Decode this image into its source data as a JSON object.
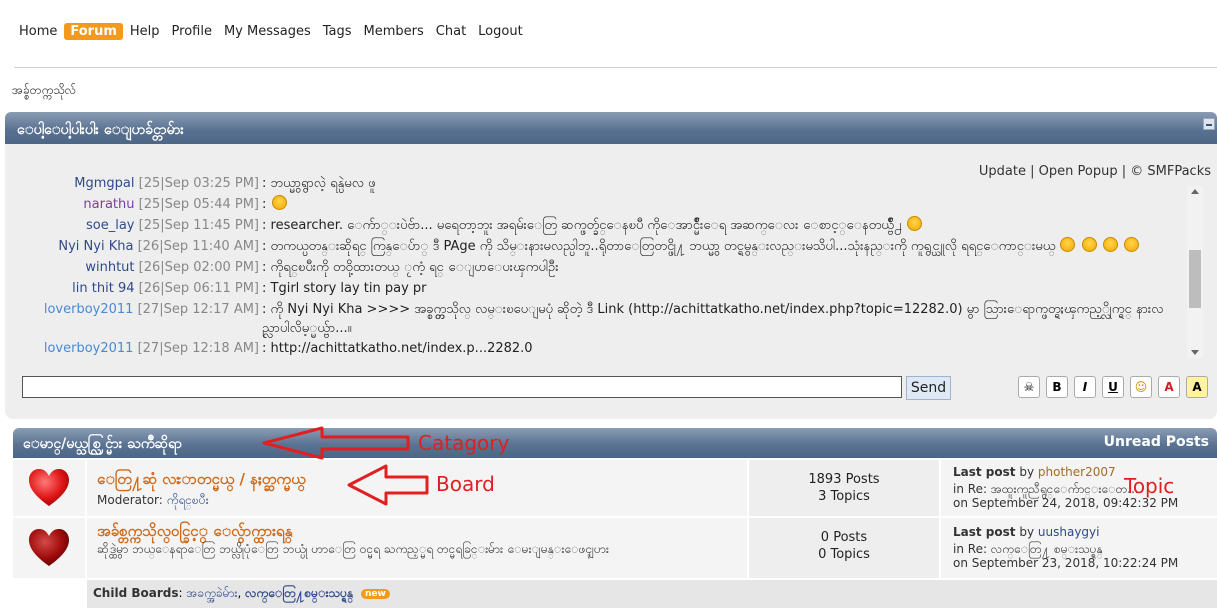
{
  "nav": {
    "items": [
      "Home",
      "Forum",
      "Help",
      "Profile",
      "My Messages",
      "Tags",
      "Members",
      "Chat",
      "Logout"
    ],
    "active": "Forum"
  },
  "breadcrumb": "အခ္စ်တက္ကသိုလ်",
  "shoutbox": {
    "title": "ေပါ့ေပါ့ပါးပါး ေျပာခ်င္တာမ်ား",
    "links": {
      "update": "Update",
      "sep1": "|",
      "popup": "Open Popup",
      "sep2": "|",
      "credit": "© SMFPacks"
    },
    "shouts": [
      {
        "name": "Mgmgpal",
        "color": "#2f4a8a",
        "time": "[25|Sep 03:25 PM]",
        "msg": ": ဘယ္မွာရွာလဲ့ ရန္ပဲမလ ဖူ"
      },
      {
        "name": "narathu",
        "color": "#7a3fa0",
        "time": "[25|Sep 05:44 PM]",
        "msg": ": "
      },
      {
        "name": "soe_lay",
        "color": "#2f4a8a",
        "time": "[25|Sep 11:45 PM]",
        "msg": ": researcher. ေက်ာ္းပဲဗ်ာ... မရေတာ့ဘူး အရမ်းေတြ ဆက္ဖတ္ခ်င္ေနၿပီ ကိုေအာင္မ်ိဳးေရ အဆက္ေလး ေစာင့္ေနတယ္ဗ်ိဳ႕"
      },
      {
        "name": "Nyi Nyi Kha",
        "color": "#2f4a8a",
        "time": "[26|Sep 11:40 AM]",
        "msg": ": တကယ္ပတန္းဆိုရင္ ကြန္ေပ်ာ္ ဒီ PAge ကို သိမ္းနားမလည္ပါဘူ..ရိုတာေတြတင္ဖို႔ ဘယ္မွာ တင္ရမွန္းလည္းမသိပါ...သုံးနည္းကို ကူရွင္ယူလို ရရင္ေကာင္းမယ္"
      },
      {
        "name": "winhtut",
        "color": "#2f4a8a",
        "time": "[26|Sep 02:00 PM]",
        "msg": ": ကိုရင္ၿပီးကို တဝို့ထားတယ္ ႂကံ့ ရင္ ေျပာေပးၾကပါဦး"
      },
      {
        "name": "lin thit 94",
        "color": "#2f4a8a",
        "time": "[26|Sep 06:11 PM]",
        "msg": ": Tgirl story lay tin pay pr"
      },
      {
        "name": "loverboy2011",
        "color": "#4a8ad0",
        "time": "[27|Sep 12:17 AM]",
        "msg": ": ကို Nyi Nyi Kha >>>> အခ္စ္တက္ကသိုလ္ လမ္းၿပေျမပုံ ဆိုတဲ့ ဒီ Link (http://achittatkatho.net/index.php?topic=12282.0) မွာ သြားေရာက္ဖတ္ရႈၾကည့္လိုက္ရင္ နားလည္လာပါလိမ့္မယ္ဗ်ာ...။"
      },
      {
        "name": "loverboy2011",
        "color": "#4a8ad0",
        "time": "[27|Sep 12:18 AM]",
        "msg": ": http://achittatkatho.net/index.p...2282.0"
      }
    ],
    "send_label": "Send",
    "tools": [
      "☠",
      "B",
      "I",
      "U",
      "☺",
      "A",
      "A"
    ]
  },
  "category": {
    "title": "ေမာင္/မယ္သစ္လြင္မ်ား ႀကိဳဆိုရာ",
    "unread": "Unread Posts"
  },
  "boards": [
    {
      "name": "ေတြ႔ဆုံ လႊာတင္မယ္ / နႈတ္ဆက္မယ္",
      "moderator_label": "Moderator:",
      "moderator": "ကိုရင္ၿပီး",
      "posts": "1893 Posts",
      "topics": "3 Topics",
      "last_label": "Last post",
      "by": "by",
      "poster": "phother2007",
      "in": "in",
      "topic": "Re: အထူးကူညီရွင္ေက်ာင္းေတ...",
      "on": "on September 24, 2018, 09:42:32 PM"
    },
    {
      "name": "အခ်စ္တက္ကသိုလ္ဝင္ခြင့္ ေလွ်ာက္ထားရန္",
      "desc": "ဆိုဒ္ထဲမွာ ဘယ္ေနရာေတြ ဘယ္လိုပုံေတြ ဘယ္ပုံ ဟာေတြ ဝင္မရ ႀကည့္မရ တင္မရခြင္းမ်ား ေမးျမန္းေဖၚျပား",
      "posts": "0 Posts",
      "topics": "0 Topics",
      "last_label": "Last post",
      "by": "by",
      "poster": "uushaygyi",
      "in": "in",
      "topic": "Re: လက္ေတြ႔ စမ္းသပ္ရန္",
      "on": "on September 23, 2018, 10:22:24 PM"
    }
  ],
  "child_boards": {
    "label": "Child Boards",
    "colon": ":",
    "items": [
      "အခက္အခဲမ်ား",
      "လက္ေတြ႔စမ္းသပ္ရန္"
    ],
    "new": "new"
  },
  "annotations": {
    "category": "Catagory",
    "board": "Board",
    "topic": "Topic"
  }
}
